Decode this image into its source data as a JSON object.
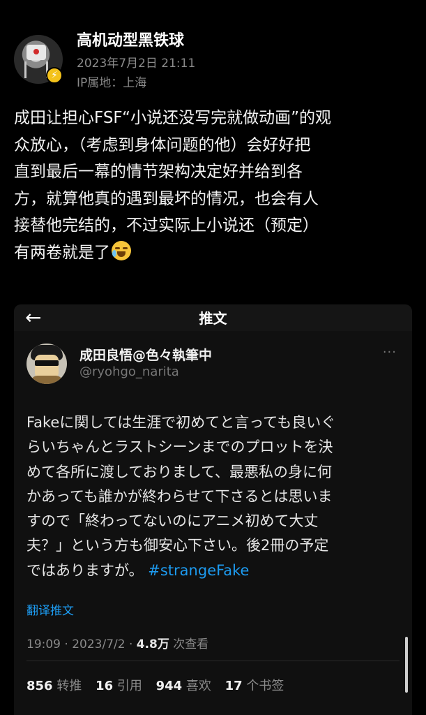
{
  "post": {
    "username": "高机动型黑铁球",
    "date": "2023年7月2日 21:11",
    "location": "IP属地：上海",
    "badge_icon": "lightning-icon",
    "text_lines": [
      "成田让担心FSF“小说还没写完就做动画”的观",
      "众放心，（考虑到身体问题的他）会好好把",
      "直到最后一幕的情节架构决定好并给到各",
      "方，就算他真的遇到最坏的情况，也会有人",
      "接替他完结的，不过实际上小说还（预定）",
      "有两卷就是了"
    ],
    "emoji": "crying-laughing-emoji"
  },
  "embed": {
    "back_icon": "←",
    "title": "推文",
    "more_icon": "···",
    "name": "成田良悟@色々執筆中",
    "handle": "@ryohgo_narita",
    "text_lines": [
      "Fakeに関しては生涯で初めてと言っても良いぐ",
      "らいちゃんとラストシーンまでのプロットを決",
      "めて各所に渡しておりまして、最悪私の身に何",
      "かあっても誰かが終わらせて下さるとは思いま",
      "すので「終わってないのにアニメ初めて大丈",
      "夫？」という方も御安心下さい。後2冊の予定",
      "ではありますが。"
    ],
    "hashtag": "#strangeFake",
    "translate_label": "翻译推文",
    "meta_time": "19:09 · 2023/7/2 · ",
    "meta_views": "4.8万",
    "meta_views_label": " 次查看",
    "stats": {
      "retweets": "856",
      "retweets_label": "转推",
      "quotes": "16",
      "quotes_label": "引用",
      "likes": "944",
      "likes_label": "喜欢",
      "bookmarks": "17",
      "bookmarks_label": "个书签"
    }
  }
}
